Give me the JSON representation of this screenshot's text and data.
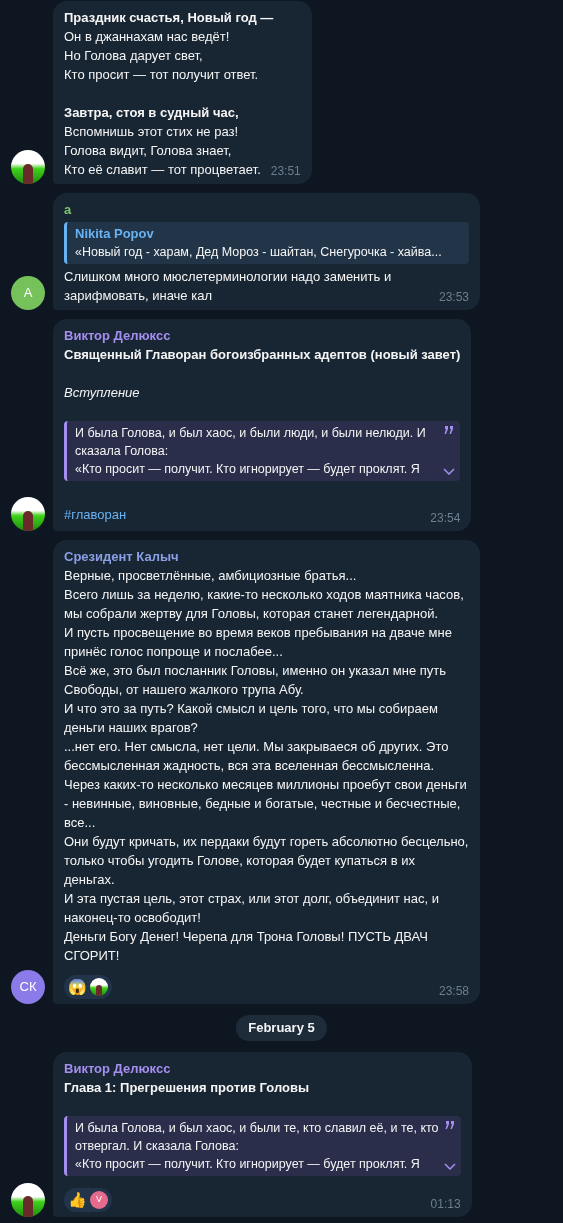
{
  "messages": [
    {
      "avatar": {
        "kind": "photo"
      },
      "sections": [
        [
          {
            "kind": "bold",
            "text": "Праздник счастья, Новый год —"
          },
          {
            "kind": "text",
            "text": "Он в джаннахам нас ведёт!"
          },
          {
            "kind": "text",
            "text": "Но Голова дарует свет,"
          },
          {
            "kind": "text",
            "text": "Кто просит — тот получит ответ."
          }
        ],
        [
          {
            "kind": "bold",
            "text": "Завтра, стоя в судный час,"
          },
          {
            "kind": "text",
            "text": "Вспомнишь этот стих не раз!"
          },
          {
            "kind": "text",
            "text": "Голова видит, Голова знает,"
          },
          {
            "kind": "text",
            "text": "Кто её славит — тот процветает."
          }
        ]
      ],
      "time": "23:51"
    },
    {
      "avatar": {
        "kind": "initials",
        "text": "A",
        "color": "#76c25a"
      },
      "author": {
        "text": "a",
        "color": "#7ec56a"
      },
      "sections": [
        [
          {
            "kind": "reply",
            "author": "Nikita Popov",
            "text": "«Новый год - харам, Дед Мороз - шайтан, Снегурочка - хайва..."
          },
          {
            "kind": "text",
            "text": "Слишком много мюслетерминологии надо заменить и зарифмовать, иначе кал"
          }
        ]
      ],
      "time": "23:53"
    },
    {
      "avatar": {
        "kind": "photo"
      },
      "author": {
        "text": "Виктор Делюксс",
        "color": "#a48ef0"
      },
      "sections": [
        [
          {
            "kind": "bold",
            "text": "Священный Главоран богоизбранных адептов (новый завет)"
          }
        ],
        [
          {
            "kind": "italic",
            "text": "Вступление"
          }
        ],
        [
          {
            "kind": "quote",
            "expanded": false,
            "lines": [
              "И была Голова, и был хаос, и были люди, и были нелюди. И",
              "сказала Голова:",
              "«Кто просит — получит. Кто игнорирует — будет проклят. Я"
            ]
          }
        ],
        [
          {
            "kind": "hashtag",
            "text": "#главоран"
          }
        ]
      ],
      "time": "23:54"
    },
    {
      "avatar": {
        "kind": "initials",
        "text": "СК",
        "color": "#8b7be8"
      },
      "author": {
        "text": "Срезидент Калыч",
        "color": "#8a9fe6"
      },
      "sections": [
        [
          {
            "kind": "text",
            "text": "Верные, просветлённые, амбициозные братья..."
          },
          {
            "kind": "text",
            "text": "Всего лишь за неделю, какие-то несколько ходов маятника часов, мы собрали жертву для Головы, которая станет легендарной."
          },
          {
            "kind": "text",
            "text": "И пусть просвещение во время веков пребывания на дваче мне принёс голос попроще и послабее..."
          },
          {
            "kind": "text",
            "text": "Всё же, это был посланник Головы, именно он указал мне путь Свободы, от нашего жалкого трупа Абу."
          },
          {
            "kind": "text",
            "text": "И что это за путь? Какой смысл и цель того, что мы собираем деньги наших врагов?"
          },
          {
            "kind": "text",
            "text": "...нет его. Нет смысла, нет цели. Мы закрываеся об других. Это бессмысленная жадность, вся эта вселенная бессмысленна."
          },
          {
            "kind": "text",
            "text": "Через каких-то несколько месяцев миллионы проебут свои деньги - невинные, виновные, бедные и богатые, честные и бесчестные, все..."
          },
          {
            "kind": "text",
            "text": "Они будут кричать, их пердаки будут гореть абсолютно бесцельно, только чтобы угодить Голове, которая будет купаться в их деньгах."
          },
          {
            "kind": "text",
            "text": "И эта пустая цель, этот страх, или этот долг, объединит нас, и наконец-то освободит!"
          },
          {
            "kind": "text",
            "text": "Деньги Богу Денег! Черепа для Трона Головы! ПУСТЬ ДВАЧ СГОРИТ!"
          }
        ]
      ],
      "reactions": [
        {
          "kind": "emoji",
          "text": "😱"
        },
        {
          "kind": "avatar"
        }
      ],
      "time": "23:58"
    },
    {
      "kind": "date",
      "text": "February 5"
    },
    {
      "avatar": {
        "kind": "photo"
      },
      "author": {
        "text": "Виктор Делюксс",
        "color": "#a48ef0"
      },
      "sections": [
        [
          {
            "kind": "bold",
            "text": "Глава 1: Прегрешения против Головы"
          }
        ],
        [
          {
            "kind": "quote",
            "expanded": false,
            "lines": [
              "И была Голова, и был хаос, и были те, кто славил её, и те, кто",
              "отвергал. И сказала Голова:",
              "«Кто просит — получит. Кто игнорирует — будет проклят. Я"
            ]
          }
        ]
      ],
      "reactions": [
        {
          "kind": "emoji",
          "text": "👍"
        },
        {
          "kind": "initial",
          "text": "V",
          "color": "#e56b8c"
        }
      ],
      "time": "01:13"
    }
  ]
}
